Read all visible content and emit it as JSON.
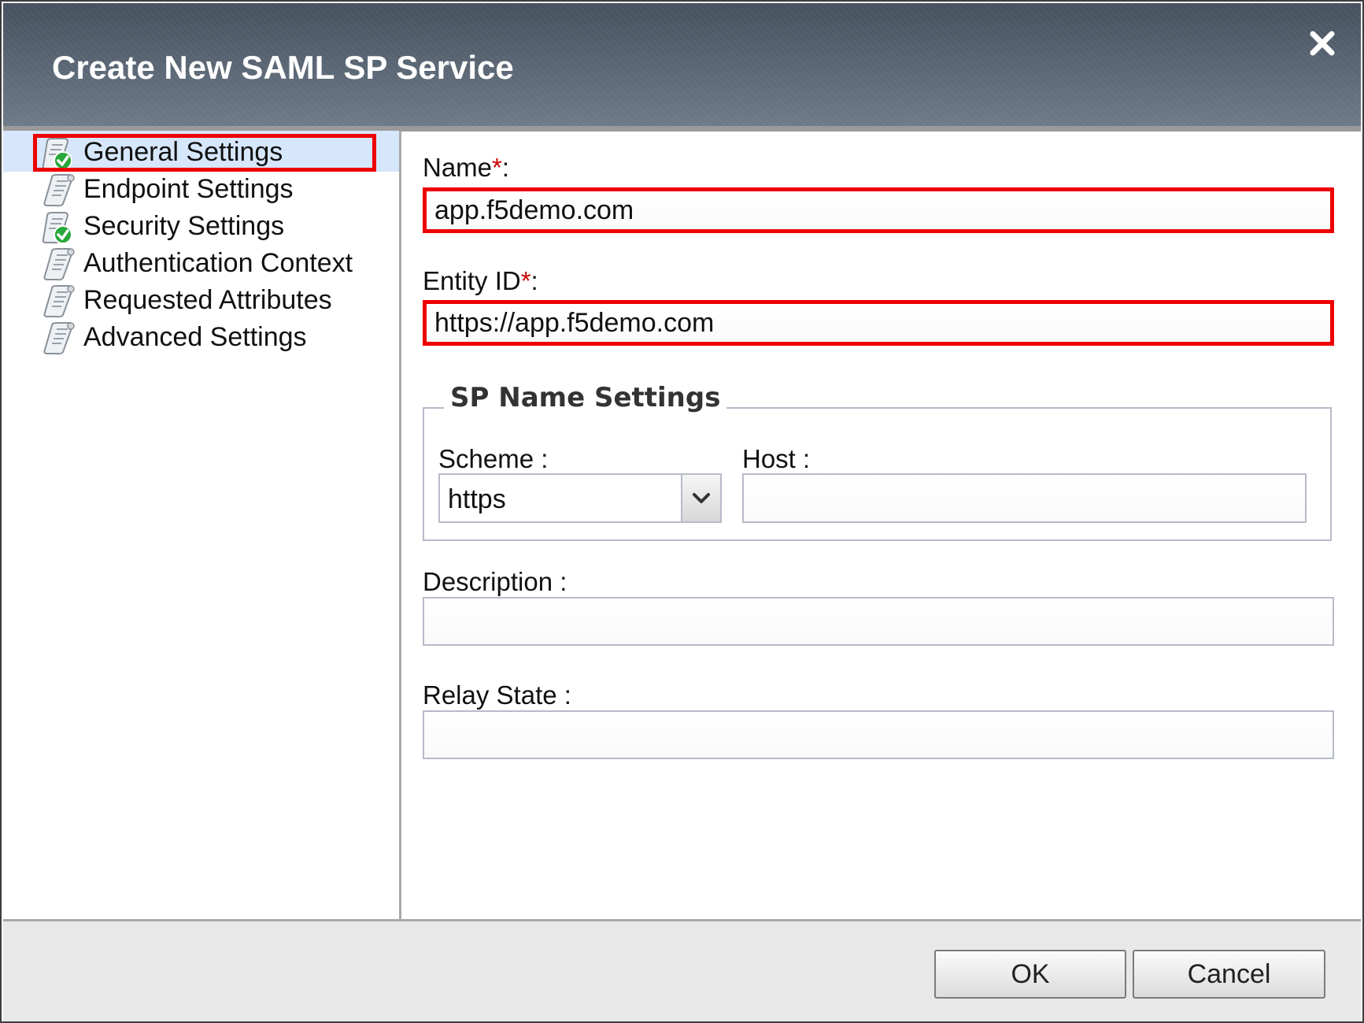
{
  "dialog": {
    "title": "Create New SAML SP Service",
    "close_icon": "close-icon"
  },
  "sidebar": {
    "items": [
      {
        "label": "General Settings",
        "icon": "scroll-check-icon",
        "selected": true,
        "highlighted": true
      },
      {
        "label": "Endpoint Settings",
        "icon": "scroll-icon"
      },
      {
        "label": "Security Settings",
        "icon": "scroll-check-icon"
      },
      {
        "label": "Authentication Context",
        "icon": "scroll-icon"
      },
      {
        "label": "Requested Attributes",
        "icon": "scroll-icon"
      },
      {
        "label": "Advanced Settings",
        "icon": "scroll-icon"
      }
    ]
  },
  "form": {
    "name": {
      "label": "Name",
      "required_mark": "*",
      "suffix": ":",
      "value": "app.f5demo.com",
      "highlighted": true
    },
    "entity_id": {
      "label": "Entity ID",
      "required_mark": "*",
      "suffix": ":",
      "value": "https://app.f5demo.com",
      "highlighted": true
    },
    "sp_name_settings": {
      "legend": "SP Name Settings",
      "scheme": {
        "label": "Scheme :",
        "value": "https"
      },
      "host": {
        "label": "Host :",
        "value": ""
      }
    },
    "description": {
      "label": "Description :",
      "value": ""
    },
    "relay_state": {
      "label": "Relay State :",
      "value": ""
    }
  },
  "footer": {
    "ok_label": "OK",
    "cancel_label": "Cancel"
  },
  "colors": {
    "highlight": "#ee0000",
    "required": "#cc0000",
    "selected_bg": "#d6e6fb",
    "titlebar": "#5a6674"
  }
}
